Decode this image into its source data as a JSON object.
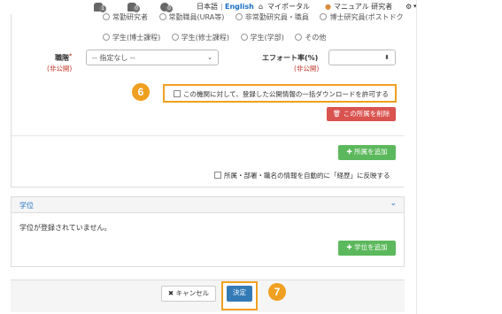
{
  "header": {
    "badges": [
      {
        "icon": "person-icon",
        "count": "1"
      },
      {
        "icon": "group-icon",
        "count": "0"
      },
      {
        "icon": "settings-icon",
        "count": "0"
      }
    ],
    "lang_ja": "日本語",
    "lang_sep": "|",
    "lang_en": "English",
    "my_portal": "マイポータル",
    "user_name": "マニュアル 研究者",
    "gear_caret": "▾"
  },
  "affiliation": {
    "position_options_row1": [
      "常勤研究者",
      "常勤職員(URA等)",
      "非常勤研究員・職員",
      "博士研究員(ポストドク)"
    ],
    "position_options_row2": [
      "学生(博士課程)",
      "学生(修士課程)",
      "学生(学部)",
      "その他"
    ],
    "title_label": "職階",
    "title_required": "*",
    "title_private": "(非公開)",
    "title_select_value": "-- 指定なし --",
    "effort_label": "エフォート率(%)",
    "effort_private": "(非公開)",
    "effort_value": "",
    "step6": "6",
    "bulk_download_label": "この機関に対して、登録した公開情報の一括ダウンロードを許可する",
    "delete_button": "この所属を削除",
    "add_button": "所属を追加",
    "reflect_label": "所属・部署・職名の情報を自動的に「経歴」に反映する"
  },
  "degree": {
    "title": "学位",
    "empty_message": "学位が登録されていません。",
    "add_button": "学位を追加"
  },
  "footer": {
    "cancel_button": "キャンセル",
    "submit_button": "決定",
    "step7": "7"
  },
  "colors": {
    "callout": "#f0a020",
    "red": "#d9534f",
    "green": "#5cb85c",
    "blue": "#337ab7",
    "link_blue": "#1a6fc4"
  }
}
